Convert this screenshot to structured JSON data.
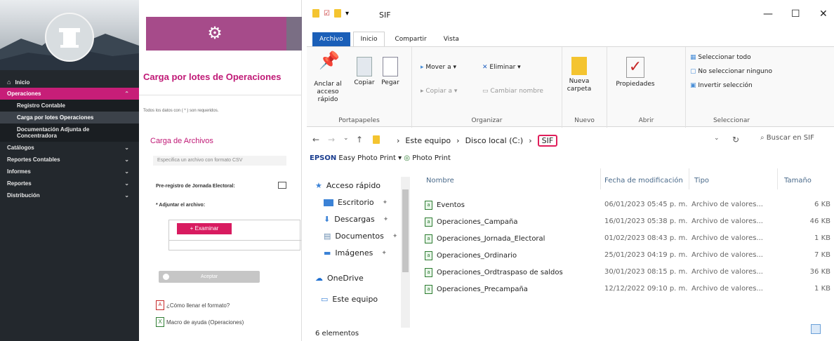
{
  "sidebar": {
    "items": [
      {
        "label": "Inicio"
      },
      {
        "label": "Operaciones"
      },
      {
        "label": "Registro Contable"
      },
      {
        "label": "Carga por lotes Operaciones"
      },
      {
        "label": "Documentación Adjunta de Concentradora"
      },
      {
        "label": "Catálogos"
      },
      {
        "label": "Reportes Contables"
      },
      {
        "label": "Informes"
      },
      {
        "label": "Reportes"
      },
      {
        "label": "Distribución"
      }
    ]
  },
  "form": {
    "title": "Carga por lotes de Operaciones",
    "required_note": "Todos los datos con ( * ) son requeridos.",
    "section_title": "Carga de Archivos",
    "csv_hint": "Especifica un archivo con formato CSV",
    "pre_registro_label": "Pre-registro de Jornada Electoral:",
    "adjuntar_label": "* Adjuntar el archivo:",
    "examinar_label": "+ Examinar",
    "aceptar_label": "Aceptar",
    "help_pdf": "¿Cómo llenar el formato?",
    "help_macro": "Macro de ayuda (Operaciones)"
  },
  "explorer": {
    "window_title": "SIF",
    "tabs": [
      "Archivo",
      "Inicio",
      "Compartir",
      "Vista"
    ],
    "ribbon": {
      "portapapeles": {
        "title": "Portapapeles",
        "anclar": "Anclar al acceso rápido",
        "copiar": "Copiar",
        "pegar": "Pegar"
      },
      "organizar": {
        "title": "Organizar",
        "mover": "Mover a",
        "eliminar": "Eliminar",
        "copiar_a": "Copiar a",
        "cambiar": "Cambiar nombre"
      },
      "nuevo": {
        "title": "Nuevo",
        "nueva_carpeta": "Nueva carpeta"
      },
      "abrir": {
        "title": "Abrir",
        "propiedades": "Propiedades"
      },
      "seleccionar": {
        "title": "Seleccionar",
        "todo": "Seleccionar todo",
        "ninguno": "No seleccionar ninguno",
        "invertir": "Invertir selección"
      }
    },
    "breadcrumb": [
      "Este equipo",
      "Disco local (C:)",
      "SIF"
    ],
    "search_placeholder": "Buscar en SIF",
    "epson_bar": {
      "brand": "EPSON",
      "app": "Easy Photo Print",
      "photo": "Photo Print"
    },
    "nav_pane": [
      "Acceso rápido",
      "Escritorio",
      "Descargas",
      "Documentos",
      "Imágenes",
      "OneDrive",
      "Este equipo"
    ],
    "columns": [
      "Nombre",
      "Fecha de modificación",
      "Tipo",
      "Tamaño"
    ],
    "files": [
      {
        "name": "Eventos",
        "date": "06/01/2023 05:45 p. m.",
        "type": "Archivo de valores...",
        "size": "6 KB"
      },
      {
        "name": "Operaciones_Campaña",
        "date": "16/01/2023 05:38 p. m.",
        "type": "Archivo de valores...",
        "size": "46 KB"
      },
      {
        "name": "Operaciones_Jornada_Electoral",
        "date": "01/02/2023 08:43 p. m.",
        "type": "Archivo de valores...",
        "size": "1 KB"
      },
      {
        "name": "Operaciones_Ordinario",
        "date": "25/01/2023 04:19 p. m.",
        "type": "Archivo de valores...",
        "size": "7 KB"
      },
      {
        "name": "Operaciones_Ordtraspaso de saldos",
        "date": "30/01/2023 08:15 p. m.",
        "type": "Archivo de valores...",
        "size": "36 KB"
      },
      {
        "name": "Operaciones_Precampaña",
        "date": "12/12/2022 09:10 p. m.",
        "type": "Archivo de valores...",
        "size": "1 KB"
      }
    ],
    "status": "6 elementos"
  }
}
